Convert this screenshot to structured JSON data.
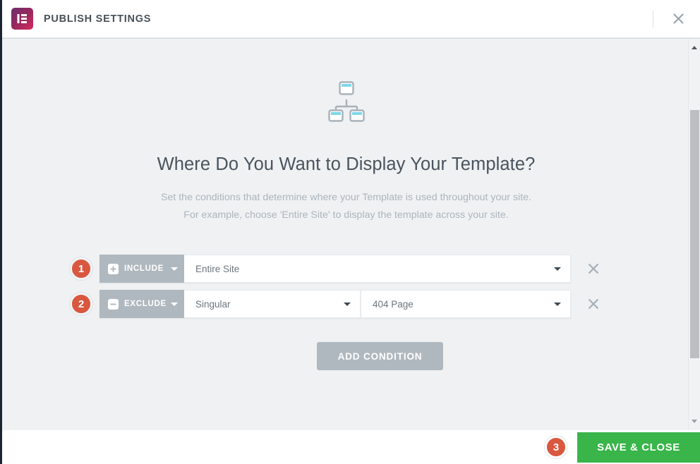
{
  "header": {
    "title": "PUBLISH SETTINGS",
    "logo_icon": "elementor-logo-icon",
    "close_icon": "close-icon"
  },
  "main": {
    "hero_icon": "sitemap-icon",
    "heading": "Where Do You Want to Display Your Template?",
    "subtext_line1": "Set the conditions that determine where your Template is used throughout your site.",
    "subtext_line2": "For example, choose 'Entire Site' to display the template across your site.",
    "add_condition_label": "ADD CONDITION",
    "conditions": [
      {
        "step": "1",
        "type_label": "INCLUDE",
        "type_icon": "plus-square-icon",
        "value_primary": "Entire Site",
        "value_secondary": null,
        "remove_icon": "close-icon"
      },
      {
        "step": "2",
        "type_label": "EXCLUDE",
        "type_icon": "minus-square-icon",
        "value_primary": "Singular",
        "value_secondary": "404 Page",
        "remove_icon": "close-icon"
      }
    ]
  },
  "scrollbar": {
    "up_icon": "chevron-up-icon",
    "down_icon": "chevron-down-icon"
  },
  "footer": {
    "step": "3",
    "save_label": "SAVE & CLOSE"
  },
  "colors": {
    "accent_badge": "#d9573f",
    "save_button": "#39b54a",
    "control_gray": "#b0b8bf",
    "body_bg": "#eff1f3",
    "heading_text": "#4a545e",
    "muted_text": "#adb5bd"
  }
}
